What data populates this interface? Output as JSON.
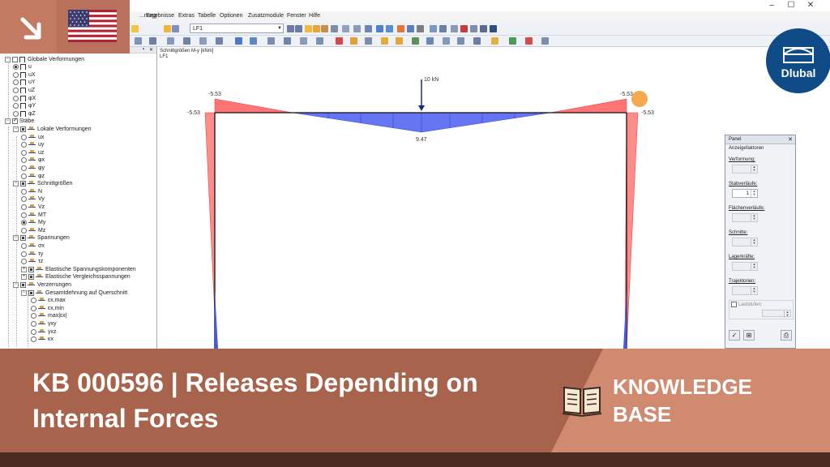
{
  "menubar": {
    "items": [
      "...nung",
      "Ergebnisse",
      "Extras",
      "Tabelle",
      "Optionen",
      "Zusatzmodule",
      "Fenster",
      "Hilfe"
    ]
  },
  "toolbar": {
    "loadcase_value": "LF1"
  },
  "navigator": {
    "items": [
      {
        "label": "Globale Verformungen",
        "level": 0,
        "kind": "checkbox",
        "state": "off",
        "expander": "-",
        "glyph": "frame"
      },
      {
        "label": "u",
        "level": 1,
        "kind": "radio",
        "state": "on",
        "glyph": "frame"
      },
      {
        "label": "uX",
        "level": 1,
        "kind": "radio",
        "state": "off",
        "glyph": "frame"
      },
      {
        "label": "uY",
        "level": 1,
        "kind": "radio",
        "state": "off",
        "glyph": "frame"
      },
      {
        "label": "uZ",
        "level": 1,
        "kind": "radio",
        "state": "off",
        "glyph": "frame"
      },
      {
        "label": "φX",
        "level": 1,
        "kind": "radio",
        "state": "off",
        "glyph": "frame"
      },
      {
        "label": "φY",
        "level": 1,
        "kind": "radio",
        "state": "off",
        "glyph": "frame"
      },
      {
        "label": "φZ",
        "level": 1,
        "kind": "radio",
        "state": "off",
        "glyph": "frame"
      },
      {
        "label": "Stäbe",
        "level": 0,
        "kind": "checkbox",
        "state": "checked",
        "expander": "-",
        "glyph": "none"
      },
      {
        "label": "Lokale Verformungen",
        "level": 1,
        "kind": "checkbox",
        "state": "partial",
        "expander": "-",
        "glyph": "member"
      },
      {
        "label": "ux",
        "level": 2,
        "kind": "radio",
        "state": "off",
        "glyph": "member"
      },
      {
        "label": "uy",
        "level": 2,
        "kind": "radio",
        "state": "off",
        "glyph": "member"
      },
      {
        "label": "uz",
        "level": 2,
        "kind": "radio",
        "state": "off",
        "glyph": "member"
      },
      {
        "label": "φx",
        "level": 2,
        "kind": "radio",
        "state": "off",
        "glyph": "member"
      },
      {
        "label": "φy",
        "level": 2,
        "kind": "radio",
        "state": "off",
        "glyph": "member"
      },
      {
        "label": "φz",
        "level": 2,
        "kind": "radio",
        "state": "off",
        "glyph": "member"
      },
      {
        "label": "Schnittgrößen",
        "level": 1,
        "kind": "checkbox",
        "state": "partial",
        "expander": "-",
        "glyph": "member"
      },
      {
        "label": "N",
        "level": 2,
        "kind": "radio",
        "state": "off",
        "glyph": "member"
      },
      {
        "label": "Vy",
        "level": 2,
        "kind": "radio",
        "state": "off",
        "glyph": "member"
      },
      {
        "label": "Vz",
        "level": 2,
        "kind": "radio",
        "state": "off",
        "glyph": "member"
      },
      {
        "label": "MT",
        "level": 2,
        "kind": "radio",
        "state": "off",
        "glyph": "member"
      },
      {
        "label": "My",
        "level": 2,
        "kind": "radio",
        "state": "on",
        "glyph": "member"
      },
      {
        "label": "Mz",
        "level": 2,
        "kind": "radio",
        "state": "off",
        "glyph": "member"
      },
      {
        "label": "Spannungen",
        "level": 1,
        "kind": "checkbox",
        "state": "partial",
        "expander": "-",
        "glyph": "member"
      },
      {
        "label": "σx",
        "level": 2,
        "kind": "radio",
        "state": "off",
        "glyph": "member"
      },
      {
        "label": "τy",
        "level": 2,
        "kind": "radio",
        "state": "off",
        "glyph": "member"
      },
      {
        "label": "τz",
        "level": 2,
        "kind": "radio",
        "state": "off",
        "glyph": "member"
      },
      {
        "label": "Elastische Spannungskomponenten",
        "level": 2,
        "kind": "checkbox",
        "state": "partial",
        "expander": "+",
        "glyph": "member"
      },
      {
        "label": "Elastische Vergleichsspannungen",
        "level": 2,
        "kind": "checkbox",
        "state": "partial",
        "expander": "+",
        "glyph": "member"
      },
      {
        "label": "Verzerrungen",
        "level": 1,
        "kind": "checkbox",
        "state": "partial",
        "expander": "-",
        "glyph": "member"
      },
      {
        "label": "Gesamtdehnung auf Querschnitt",
        "level": 2,
        "kind": "checkbox",
        "state": "partial",
        "expander": "-",
        "glyph": "member"
      },
      {
        "label": "εx,max",
        "level": 3,
        "kind": "radio",
        "state": "off",
        "glyph": "member"
      },
      {
        "label": "εx,min",
        "level": 3,
        "kind": "radio",
        "state": "off",
        "glyph": "member"
      },
      {
        "label": "max|εx|",
        "level": 3,
        "kind": "radio",
        "state": "off",
        "glyph": "member"
      },
      {
        "label": "γxy",
        "level": 3,
        "kind": "radio",
        "state": "off",
        "glyph": "member"
      },
      {
        "label": "γxz",
        "level": 3,
        "kind": "radio",
        "state": "off",
        "glyph": "member"
      },
      {
        "label": "κx",
        "level": 3,
        "kind": "radio",
        "state": "off",
        "glyph": "member"
      }
    ]
  },
  "graphics": {
    "caption_line1": "Schnittgrößen M-y [kNm]",
    "caption_line2": "LF1",
    "load_label": "10 kN",
    "values": {
      "left_top": "-5.53",
      "left_corner": "-5.53",
      "mid": "9.47",
      "right_top": "-5.53",
      "right_corner": "-5.53"
    },
    "colors": {
      "negative": "#f24b4b",
      "positive": "#4456f0",
      "highlight": "#f5a03c"
    }
  },
  "panel": {
    "title": "Panel",
    "subtitle": "Anzeigefaktoren",
    "groups": [
      {
        "label": "Verformung:",
        "value": "",
        "enabled": false
      },
      {
        "label": "Stabverläufe:",
        "value": "1",
        "enabled": true
      },
      {
        "label": "Flächenverläufe:",
        "value": "",
        "enabled": false
      },
      {
        "label": "Schnitte:",
        "value": "",
        "enabled": false
      },
      {
        "label": "Lagerkräfte:",
        "value": "",
        "enabled": false
      },
      {
        "label": "Trajektorien:",
        "value": "",
        "enabled": false
      }
    ],
    "loadsteps_label": "Laststufen:"
  },
  "branding": {
    "logo_text": "Dlubal",
    "colors": {
      "banner": "#a8634c",
      "banner_accent": "#cf8a6f",
      "logo": "#0f4b87"
    }
  },
  "banner": {
    "title_line1": "KB 000596 | Releases Depending on",
    "title_line2": "Internal Forces",
    "kb_line1": "KNOWLEDGE",
    "kb_line2": "BASE"
  }
}
